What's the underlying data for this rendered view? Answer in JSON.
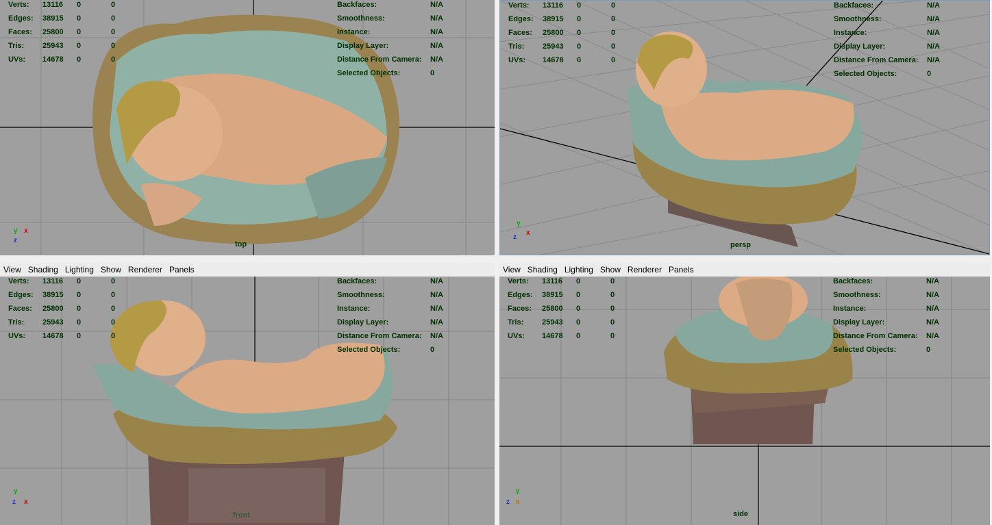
{
  "menu": [
    "View",
    "Shading",
    "Lighting",
    "Show",
    "Renderer",
    "Panels"
  ],
  "hud_left": [
    {
      "label": "Verts:",
      "v1": "13116",
      "v2": "0",
      "v3": "0"
    },
    {
      "label": "Edges:",
      "v1": "38915",
      "v2": "0",
      "v3": "0"
    },
    {
      "label": "Faces:",
      "v1": "25800",
      "v2": "0",
      "v3": "0"
    },
    {
      "label": "Tris:",
      "v1": "25943",
      "v2": "0",
      "v3": "0"
    },
    {
      "label": "UVs:",
      "v1": "14678",
      "v2": "0",
      "v3": "0"
    }
  ],
  "hud_right": [
    {
      "label": "Backfaces:",
      "value": "N/A"
    },
    {
      "label": "Smoothness:",
      "value": "N/A"
    },
    {
      "label": "Instance:",
      "value": "N/A"
    },
    {
      "label": "Display Layer:",
      "value": "N/A"
    },
    {
      "label": "Distance From Camera:",
      "value": "N/A"
    },
    {
      "label": "Selected Objects:",
      "value": "0"
    }
  ],
  "cameras": {
    "top": "top",
    "persp": "persp",
    "front": "front",
    "side": "side"
  },
  "axis_labels": {
    "x": "x",
    "y": "y",
    "z": "z"
  },
  "colors": {
    "viewport": "#9f9f9f",
    "hud_text": "#003000",
    "grid": "#7f7f7f",
    "axis_line": "#000000"
  }
}
